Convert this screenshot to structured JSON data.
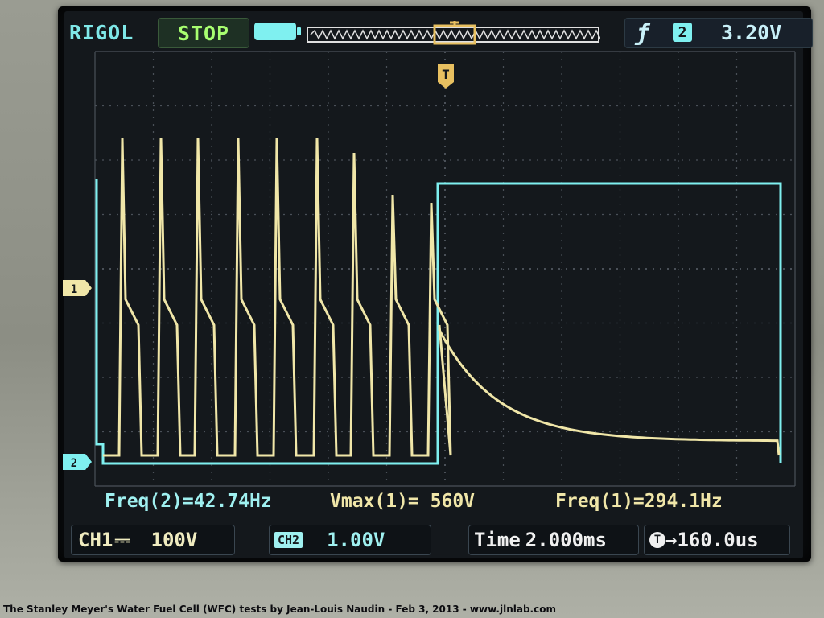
{
  "scope": {
    "brand": "RIGOL",
    "run_state": "STOP",
    "trigger": {
      "slope_icon": "falling-edge-icon",
      "source": "2",
      "level": "3.20V"
    },
    "trigger_marker": "T"
  },
  "measurements": {
    "freq2": "Freq(2)=42.74Hz",
    "vmax1": "Vmax(1)= 560V",
    "freq1": "Freq(1)=294.1Hz"
  },
  "channels": {
    "ch1": {
      "label": "CH1",
      "coupling_icon": "dc-coupling-icon",
      "scale": "100V"
    },
    "ch2": {
      "label": "CH2",
      "scale": "1.00V"
    }
  },
  "timebase": {
    "label": "Time",
    "scale": "2.000ms",
    "offset": "160.0us"
  },
  "channel_markers": {
    "ch1": "1",
    "ch2": "2"
  },
  "colors": {
    "ch1": "#f0e6a8",
    "ch2": "#7ff0f0",
    "grid": "#3a4048"
  },
  "caption": "The Stanley Meyer's Water Fuel Cell (WFC) tests by Jean-Louis Naudin - Feb 3, 2013 - www.jlnlab.com"
}
